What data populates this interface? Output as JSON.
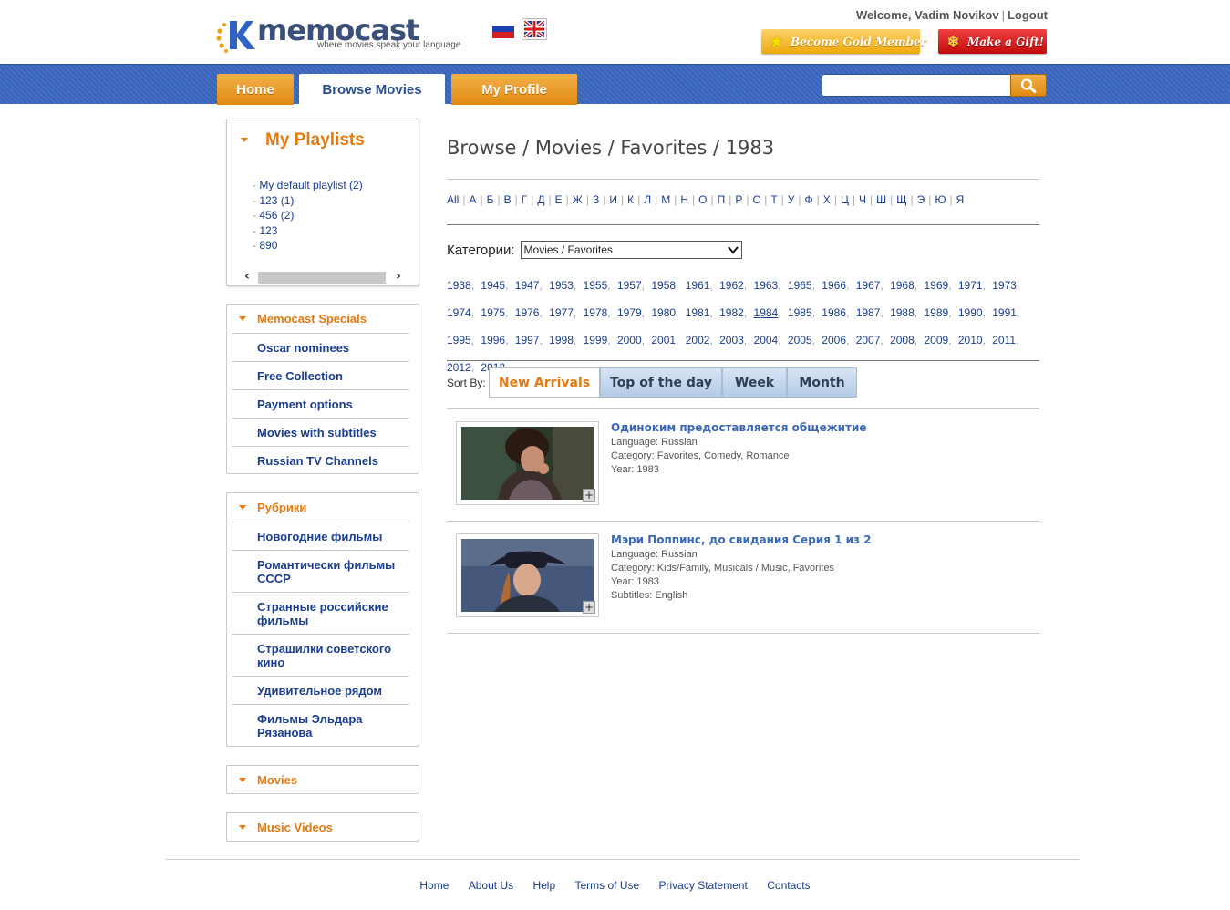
{
  "brand": {
    "name": "memocast",
    "tagline": "where movies speak your language"
  },
  "languages": [
    {
      "code": "ru",
      "icon": "russian-flag-icon"
    },
    {
      "code": "en",
      "icon": "uk-flag-icon"
    }
  ],
  "user": {
    "welcome": "Welcome, Vadim Novikov",
    "logout_label": "Logout"
  },
  "header_buttons": {
    "gold_label": "Become Gold Member",
    "gift_label": "Make a Gift!"
  },
  "nav": {
    "tabs": [
      {
        "label": "Home",
        "active": false
      },
      {
        "label": "Browse Movies",
        "active": true
      },
      {
        "label": "My Profile",
        "active": false
      }
    ],
    "search": {
      "value": "",
      "placeholder": "",
      "icon": "search-icon"
    }
  },
  "sidebar": {
    "playlists": {
      "title": "My Playlists",
      "items": [
        {
          "label": "My default playlist (2)"
        },
        {
          "label": "123 (1)"
        },
        {
          "label": "456 (2)"
        },
        {
          "label": "123"
        },
        {
          "label": "890"
        }
      ]
    },
    "specials": {
      "title": "Memocast Specials",
      "items": [
        {
          "label": "Oscar nominees"
        },
        {
          "label": "Free Collection"
        },
        {
          "label": "Payment options"
        },
        {
          "label": "Movies with subtitles"
        },
        {
          "label": "Russian TV Channels"
        }
      ]
    },
    "rubrics": {
      "title": "Рубрики",
      "items": [
        {
          "label": "Новогодние фильмы"
        },
        {
          "label": "Романтически фильмы СССР"
        },
        {
          "label": "Странные российские фильмы"
        },
        {
          "label": "Страшилки советского кино"
        },
        {
          "label": "Удивительное рядом"
        },
        {
          "label": "Фильмы Эльдара Рязанова"
        }
      ]
    },
    "movies_title": "Movies",
    "music_title": "Music Videos"
  },
  "main": {
    "breadcrumb": "Browse / Movies / Favorites / 1983",
    "alphabet": [
      "All",
      "А",
      "Б",
      "В",
      "Г",
      "Д",
      "Е",
      "Ж",
      "З",
      "И",
      "К",
      "Л",
      "М",
      "Н",
      "О",
      "П",
      "Р",
      "С",
      "Т",
      "У",
      "Ф",
      "Х",
      "Ц",
      "Ч",
      "Ш",
      "Щ",
      "Э",
      "Ю",
      "Я"
    ],
    "category": {
      "label": "Категории:",
      "selected": "Movies / Favorites"
    },
    "years": [
      "1938",
      "1945",
      "1947",
      "1953",
      "1955",
      "1957",
      "1958",
      "1961",
      "1962",
      "1963",
      "1965",
      "1966",
      "1967",
      "1968",
      "1969",
      "1971",
      "1973",
      "1974",
      "1975",
      "1976",
      "1977",
      "1978",
      "1979",
      "1980",
      "1981",
      "1982",
      "1984",
      "1985",
      "1986",
      "1987",
      "1988",
      "1989",
      "1990",
      "1991",
      "1995",
      "1996",
      "1997",
      "1998",
      "1999",
      "2000",
      "2001",
      "2002",
      "2003",
      "2004",
      "2005",
      "2006",
      "2007",
      "2008",
      "2009",
      "2010",
      "2011",
      "2012",
      "2013"
    ],
    "highlighted_year": "1984",
    "sort": {
      "label": "Sort By:",
      "tabs": [
        {
          "label": "New Arrivals",
          "active": true
        },
        {
          "label": "Top of the day",
          "active": false
        },
        {
          "label": "Week",
          "active": false
        },
        {
          "label": "Month",
          "active": false
        }
      ]
    },
    "movies": [
      {
        "title": "Одиноким предоставляется общежитие",
        "language_label": "Language:",
        "language": "Russian",
        "category_label": "Category:",
        "category": "Favorites, Comedy, Romance",
        "year_label": "Year:",
        "year": "1983"
      },
      {
        "title": "Мэри Поппинс, до свидания Серия 1 из 2",
        "language_label": "Language:",
        "language": "Russian",
        "category_label": "Category:",
        "category": "Kids/Family, Musicals / Music, Favorites",
        "year_label": "Year:",
        "year": "1983",
        "subtitles_label": "Subtitles:",
        "subtitles": "English"
      }
    ]
  },
  "footer": {
    "links": [
      "Home",
      "About Us",
      "Help",
      "Terms of Use",
      "Privacy Statement",
      "Contacts"
    ]
  },
  "colors": {
    "accent_orange": "#e57a10",
    "link_blue": "#1a3d8f",
    "nav_blue": "#3f6bbd"
  }
}
